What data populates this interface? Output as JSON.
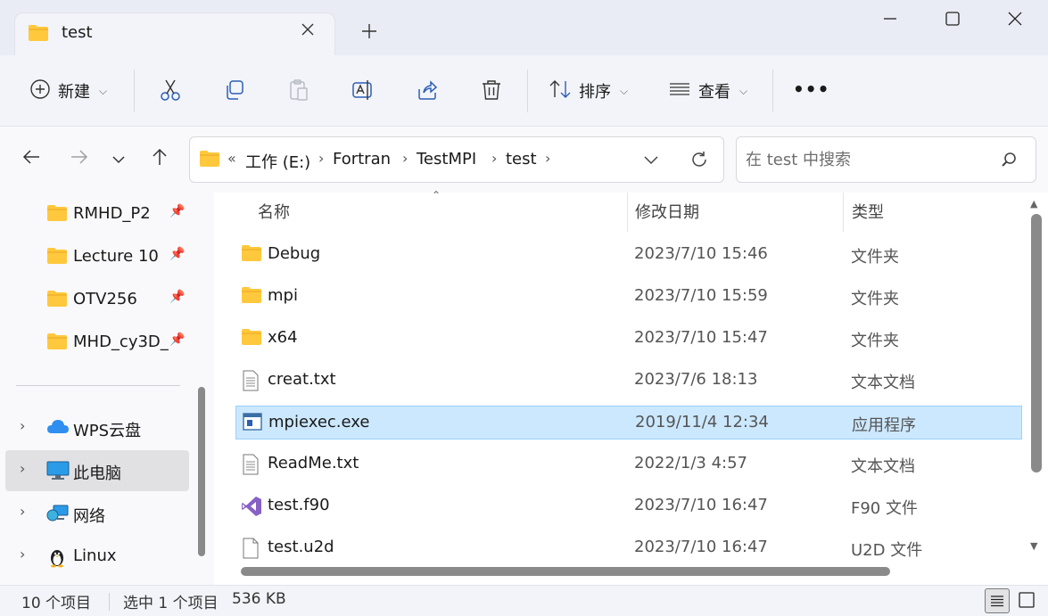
{
  "window": {
    "tab_title": "test",
    "controls": {
      "minimize": "—",
      "maximize": "☐",
      "close": "✕"
    }
  },
  "toolbar": {
    "new_label": "新建",
    "sort_label": "排序",
    "view_label": "查看",
    "more_label": "•••"
  },
  "address": {
    "overflow": "«",
    "crumbs": [
      "工作 (E:)",
      "Fortran",
      "TestMPI",
      "test"
    ]
  },
  "search": {
    "placeholder": "在 test 中搜索"
  },
  "nav": {
    "pinned": [
      "RMHD_P2",
      "Lecture 10",
      "OTV256",
      "MHD_cy3D_"
    ],
    "locations": [
      "WPS云盘",
      "此电脑",
      "网络",
      "Linux"
    ],
    "selected": "此电脑"
  },
  "columns": {
    "name": "名称",
    "date": "修改日期",
    "type": "类型"
  },
  "files": [
    {
      "name": "Debug",
      "date": "2023/7/10 15:46",
      "type": "文件夹",
      "icon": "folder-icon"
    },
    {
      "name": "mpi",
      "date": "2023/7/10 15:59",
      "type": "文件夹",
      "icon": "folder-icon"
    },
    {
      "name": "x64",
      "date": "2023/7/10 15:47",
      "type": "文件夹",
      "icon": "folder-icon"
    },
    {
      "name": "creat.txt",
      "date": "2023/7/6 18:13",
      "type": "文本文档",
      "icon": "text-file-icon"
    },
    {
      "name": "mpiexec.exe",
      "date": "2019/11/4 12:34",
      "type": "应用程序",
      "icon": "exe-icon",
      "selected": true
    },
    {
      "name": "ReadMe.txt",
      "date": "2022/1/3 4:57",
      "type": "文本文档",
      "icon": "text-file-icon"
    },
    {
      "name": "test.f90",
      "date": "2023/7/10 16:47",
      "type": "F90 文件",
      "icon": "visual-studio-icon"
    },
    {
      "name": "test.u2d",
      "date": "2023/7/10 16:47",
      "type": "U2D 文件",
      "icon": "blank-file-icon"
    }
  ],
  "status": {
    "item_count": "10 个项目",
    "selection": "选中 1 个项目",
    "size": "536 KB"
  },
  "colors": {
    "selection_bg": "#cce8ff",
    "selection_border": "#99d1ff",
    "folder_yellow": "#ffc83d"
  }
}
